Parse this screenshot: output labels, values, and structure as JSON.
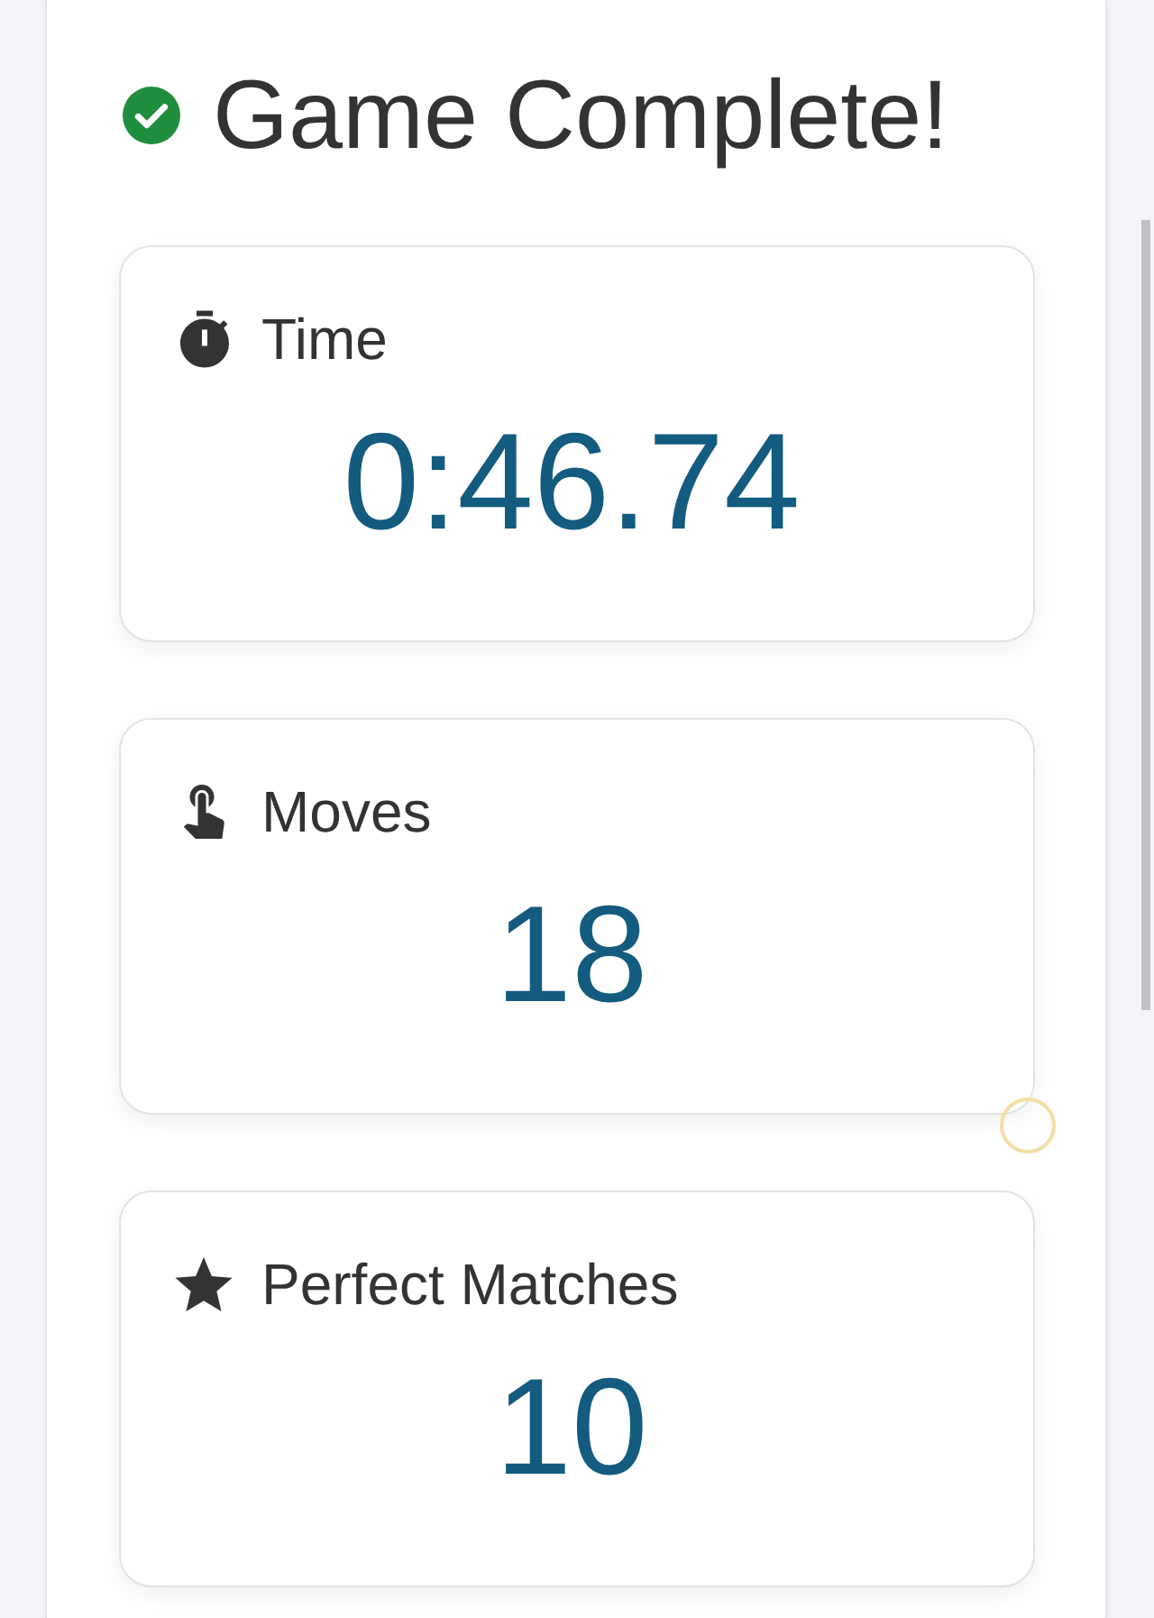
{
  "title": {
    "text": "Game Complete!"
  },
  "stats": [
    {
      "kind": "time",
      "label": "Time",
      "value": "0:46.74"
    },
    {
      "kind": "moves",
      "label": "Moves",
      "value": "18"
    },
    {
      "kind": "perfect",
      "label": "Perfect Matches",
      "value": "10"
    }
  ]
}
